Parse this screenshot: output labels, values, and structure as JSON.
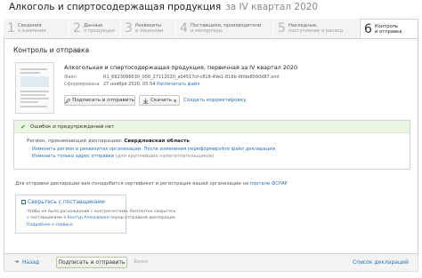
{
  "header": {
    "title": "Алкоголь и спиртосодержащая продукция",
    "subtitle": "за IV квартал 2020"
  },
  "steps": [
    {
      "num": "1",
      "line1": "Сведения",
      "line2": "о компании",
      "active": false
    },
    {
      "num": "2",
      "line1": "Данные",
      "line2": "о продукции",
      "active": false
    },
    {
      "num": "3",
      "line1": "Реквизиты",
      "line2": "и лицензии",
      "active": false
    },
    {
      "num": "4",
      "line1": "Поставщики, производители",
      "line2": "и импортеры",
      "active": false
    },
    {
      "num": "5",
      "line1": "Накладные,",
      "line2": "поступление и расход",
      "active": false
    },
    {
      "num": "6",
      "line1": "Контроль",
      "line2": "и отправка",
      "active": true
    }
  ],
  "panel": {
    "title": "Контроль и отправка"
  },
  "declaration": {
    "title": "Алкогольная и спиртосодержащая продукция, первичная за IV квартал 2020",
    "file_label": "Файл",
    "file_value": "R1_6623096630_000_27112020_a04517cf-c818-49e1-816b-fdfde8560d87.xml",
    "formed_label": "Сформирована",
    "formed_value": "27 ноября 2020, 05:54",
    "print_link": "Распечатать файл",
    "sign_button": "Подписать и отправить",
    "download_button": "Скачать",
    "fix_link": "Создать корректировку"
  },
  "check": {
    "status": "Ошибок и предупреждений нет",
    "region_label": "Регион, принимающий декларацию:",
    "region_value": "Свердловская область",
    "link1": "Изменить регион в реквизитах организации. После изменения переформируйте файл декларации.",
    "link2": "Изменить только адрес отправки",
    "link2_note": "(для крупнейших налогоплательщиков)"
  },
  "cert": {
    "text": "Для отправки декларации вам понадобится сертификат и регистрация вашей организации на",
    "link": "портале ФСРАР"
  },
  "suppliers": {
    "title": "Сверьтесь с поставщиками",
    "line1": "Чтобы не было расхождений с контрагентами, бесплатно сверьтесь",
    "line2_prefix": "с поставщиками в",
    "line2_link": "Контур.Алкосверке",
    "line2_suffix": "перед отправкой декларации.",
    "more": "Подробнее о сервисе"
  },
  "footer": {
    "back": "Назад",
    "sign": "Подписать и отправить",
    "next": "Далее",
    "list": "Список деклараций"
  },
  "icons": {
    "back": "arrow-left-icon",
    "check": "check-icon",
    "sign": "pen-icon",
    "download": "download-icon",
    "dropdown": "chevron-down-icon"
  },
  "colors": {
    "link": "#2c6fb7",
    "ok_green": "#3a9b2a",
    "ok_bg": "#eaf6e2"
  }
}
